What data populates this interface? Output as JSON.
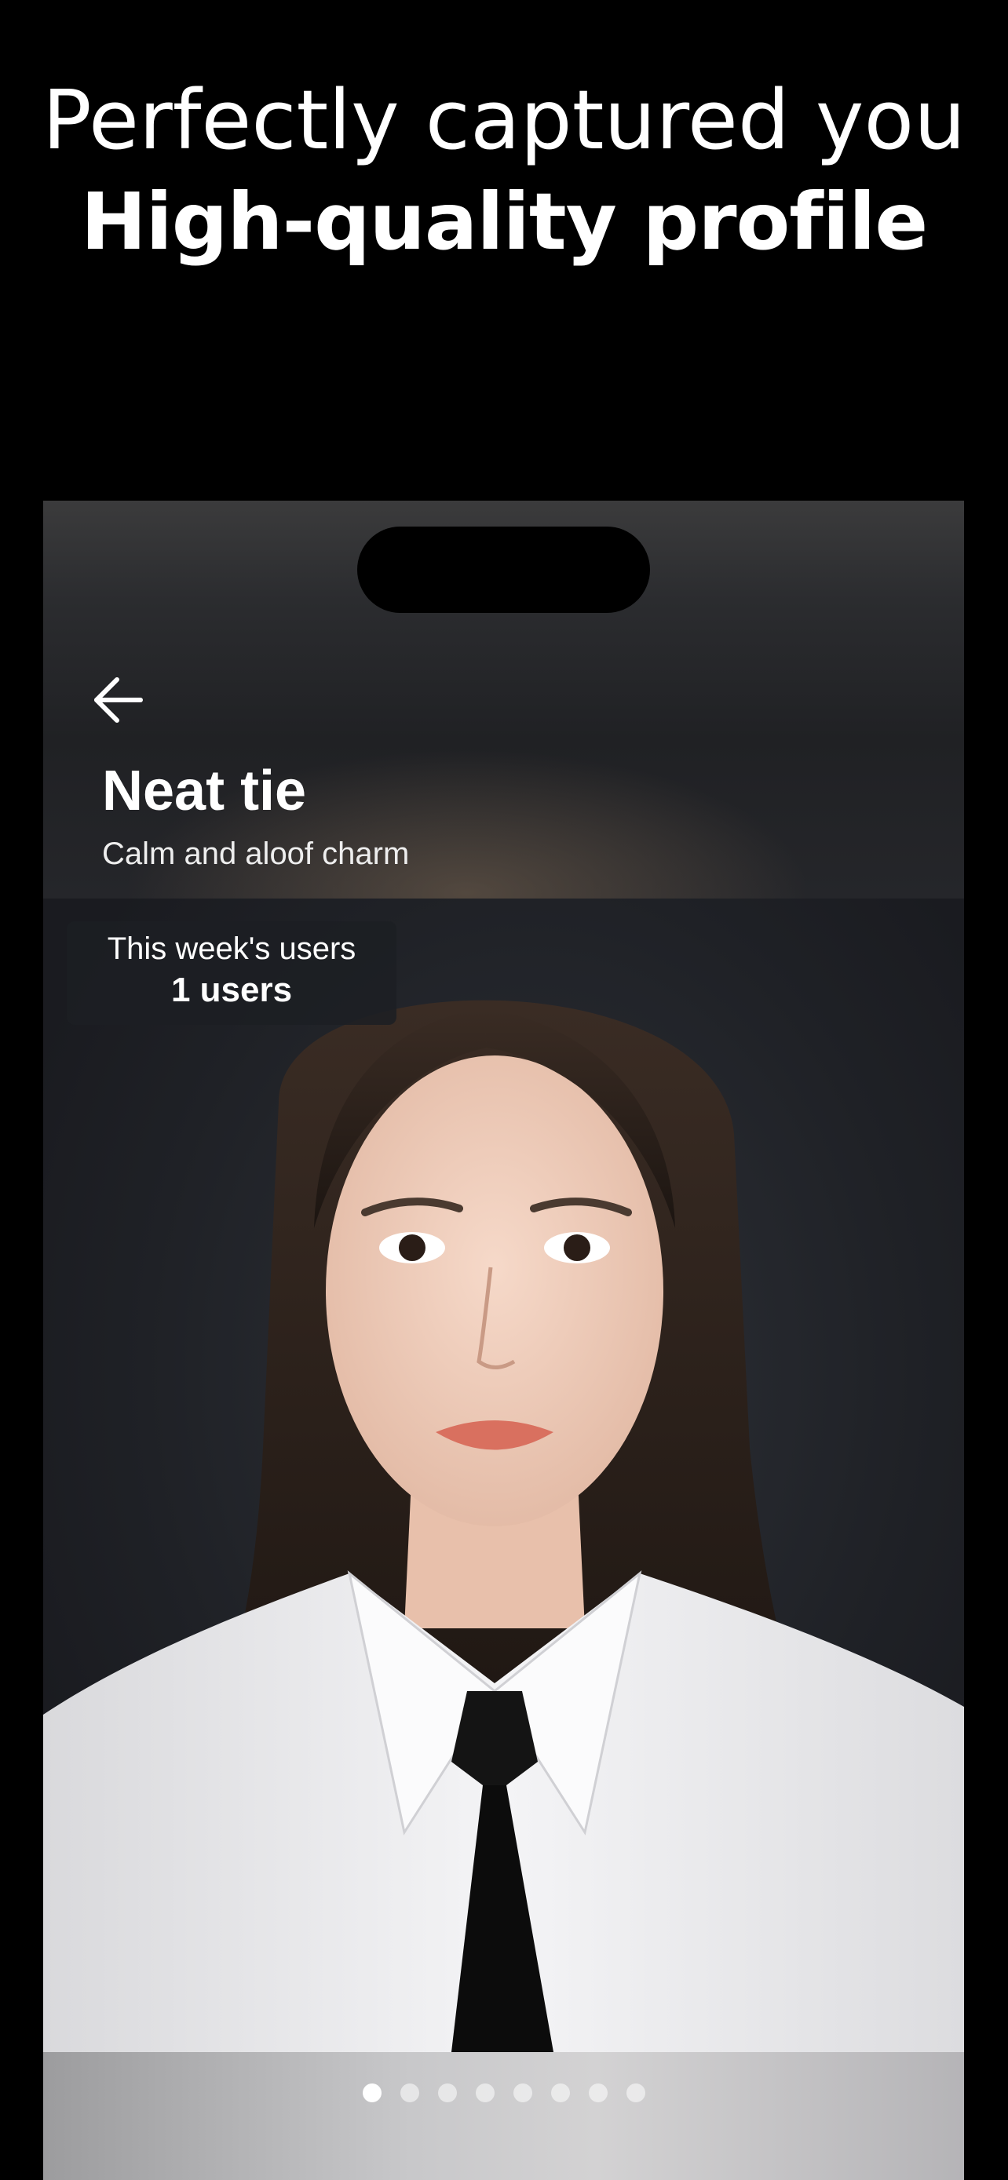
{
  "headline": {
    "line1": "Perfectly captured you",
    "line2": "High-quality profile"
  },
  "screen": {
    "back_icon": "arrow-left-icon",
    "title": "Neat tie",
    "subtitle": "Calm and aloof charm",
    "badge": {
      "label": "This week's users",
      "value": "1 users"
    },
    "carousel": {
      "count": 8,
      "active_index": 0
    }
  },
  "colors": {
    "background": "#000000",
    "text": "#ffffff",
    "badge_bg": "#1c1e23",
    "dot_active": "#ffffff",
    "dot_inactive": "#ffffff8c"
  }
}
